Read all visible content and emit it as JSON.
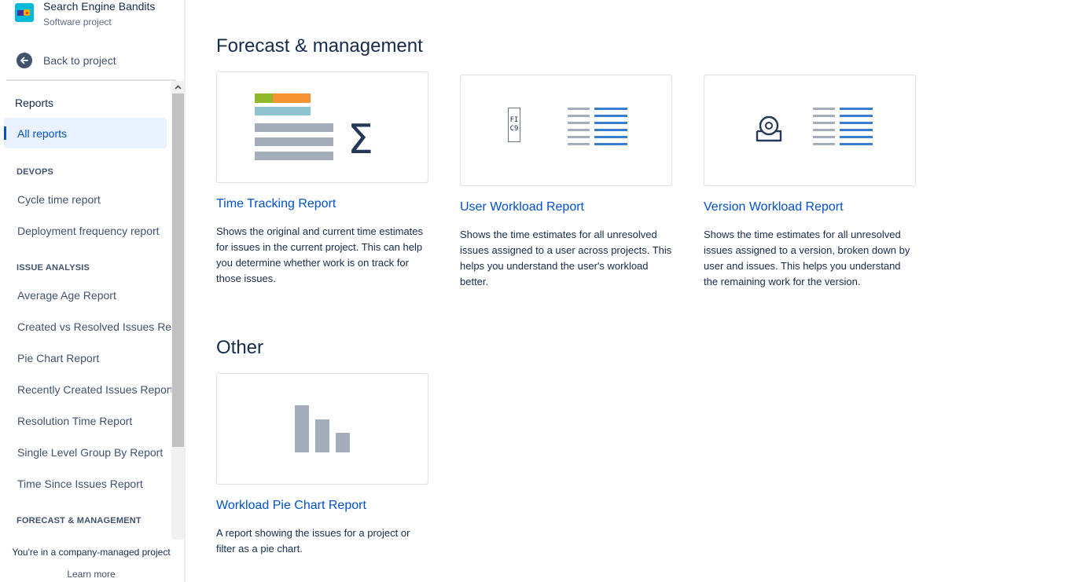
{
  "project": {
    "name": "Search Engine Bandits",
    "type": "Software project"
  },
  "nav": {
    "back_label": "Back to project",
    "title": "Reports",
    "active_item": "All reports",
    "sections": {
      "devops": "DEVOPS",
      "issue_analysis": "ISSUE ANALYSIS",
      "forecast": "FORECAST & MANAGEMENT"
    },
    "devops_items": [
      "Cycle time report",
      "Deployment frequency report"
    ],
    "issue_items": [
      "Average Age Report",
      "Created vs Resolved Issues Repo",
      "Pie Chart Report",
      "Recently Created Issues Report",
      "Resolution Time Report",
      "Single Level Group By Report",
      "Time Since Issues Report"
    ],
    "footer_note": "You're in a company-managed project",
    "footer_link": "Learn more"
  },
  "main": {
    "forecast_title": "Forecast & management",
    "other_title": "Other",
    "cards": [
      {
        "title": "Time Tracking Report",
        "description": "Shows the original and current time estimates for issues in the current project. This can help you determine whether work is on track for those issues."
      },
      {
        "title": "User Workload Report",
        "description": "Shows the time estimates for all unresolved issues assigned to a user across projects. This helps you understand the user's workload better."
      },
      {
        "title": "Version Workload Report",
        "description": "Shows the time estimates for all unresolved issues assigned to a version, broken down by user and issues. This helps you understand the remaining work for the version."
      },
      {
        "title": "Workload Pie Chart Report",
        "description": "A report showing the issues for a project or filter as a pie chart."
      }
    ]
  },
  "icons": {
    "sigma_glyph": "Σ",
    "user_avatar_text_1": "FI",
    "user_avatar_text_2": "C9"
  },
  "colors": {
    "link": "#0052cc",
    "text": "#172b4d",
    "muted": "#42526e",
    "active_bg": "#ebf2ff",
    "bar_gray": "#a5adba",
    "bar_blue": "#3c7dcf",
    "green": "#8fb82a",
    "orange": "#f79232",
    "teal": "#8dc4d0"
  }
}
